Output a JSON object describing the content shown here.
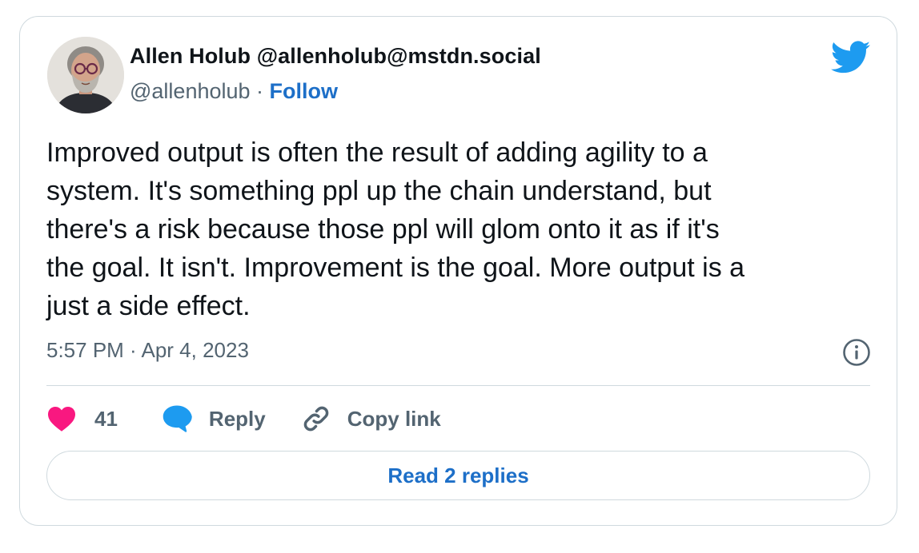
{
  "author": {
    "display_name": "Allen Holub @allenholub@mstdn.social",
    "handle": "@allenholub",
    "separator": " · ",
    "follow_label": "Follow"
  },
  "brand_icon": "twitter-bird-icon",
  "tweet": {
    "text": "Improved output is often the result of adding agility to a\nsystem. It's something ppl up the chain understand, but\nthere's a risk because those ppl will glom onto it as if it's\nthe goal. It isn't. Improvement is the goal. More output is a\njust a side effect.",
    "timestamp": "5:57 PM · Apr 4, 2023"
  },
  "actions": {
    "like_count": "41",
    "reply_label": "Reply",
    "copy_link_label": "Copy link"
  },
  "read_replies_label": "Read 2 replies",
  "icons": {
    "like": "heart-icon",
    "reply": "speech-bubble-icon",
    "copy_link": "link-icon",
    "info": "info-icon"
  },
  "colors": {
    "brand_blue": "#1d9bf0",
    "link_blue": "#1d6fc8",
    "heart_pink": "#f91880",
    "secondary_text": "#536471",
    "border": "#cfd9de"
  }
}
